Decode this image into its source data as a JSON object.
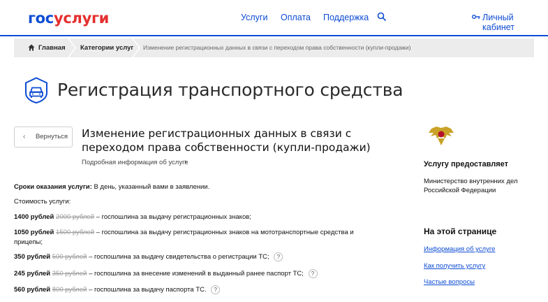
{
  "header": {
    "logo_part1": "гос",
    "logo_part2": "услуги",
    "nav": [
      "Услуги",
      "Оплата",
      "Поддержка"
    ],
    "cabinet": "Личный кабинет",
    "accent": "#0d4cd3",
    "logo_red": "#e52f2f"
  },
  "breadcrumbs": {
    "home": "Главная",
    "categories": "Категории услуг",
    "current": "Изменение регистрационных данных в связи с переходом права собственности (купли-продажи)"
  },
  "page": {
    "title": "Регистрация транспортного средства",
    "back": "Вернуться",
    "service_title": "Изменение регистрационных данных в связи с переходом права собственности (купли-продажи)",
    "more_info": "Подробная информация об услуге"
  },
  "terms": {
    "label": "Сроки оказания услуги:",
    "value": "В день, указанный вами в заявлении."
  },
  "cost": {
    "label": "Стоимость услуги:",
    "items": [
      {
        "price": "1400 рублей",
        "old": "2000 рублей",
        "desc": "– госпошлина за выдачу регистрационных знаков;"
      },
      {
        "price": "1050 рублей",
        "old": "1500 рублей",
        "desc": "– госпошлина за выдачу регистрационных знаков на мототранспортные средства и прицепы;"
      },
      {
        "price": "350 рублей",
        "old": "500 рублей",
        "desc": "– госпошлина за выдачу свидетельства о регистрации ТС;"
      },
      {
        "price": "245 рублей",
        "old": "350 рублей",
        "desc": "– госпошлина за внесение изменений в выданный ранее паспорт ТС;"
      },
      {
        "price": "560 рублей",
        "old": "800 рублей",
        "desc": "– госпошлина за выдачу паспорта ТС."
      }
    ]
  },
  "sidebar": {
    "provider_heading": "Услугу предоставляет",
    "provider": "Министерство внутренних дел Российской Федерации",
    "on_page_heading": "На этой странице",
    "links": [
      "Информация об услуге",
      "Как получить услугу",
      "Частые вопросы"
    ]
  },
  "icons": {
    "search": "search-icon",
    "key": "key-icon",
    "home": "home-icon",
    "car": "car-icon",
    "help": "?"
  }
}
